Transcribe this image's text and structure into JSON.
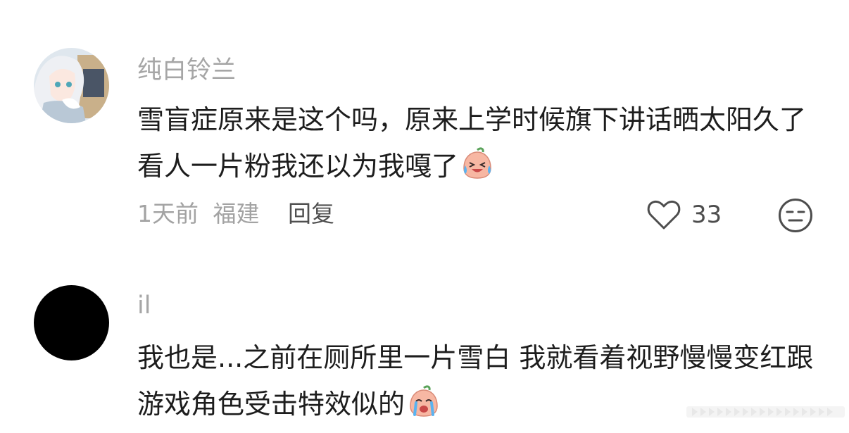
{
  "comments": [
    {
      "username": "纯白铃兰",
      "avatar_icon": "anime-girl-avatar",
      "text": "雪盲症原来是这个吗，原来上学时候旗下讲话晒太阳久了看人一片粉我还以为我嘎了",
      "emoji_icon": "crying-laughing-peach-emoji",
      "time": "1天前",
      "location": "福建",
      "reply_label": "回复",
      "like_icon": "heart-outline-icon",
      "like_count": "33",
      "dislike_icon": "neutral-face-icon"
    },
    {
      "username": "il",
      "avatar_icon": "black-circle-avatar",
      "text": "我也是...之前在厕所里一片雪白 我就看着视野慢慢变红跟游戏角色受击特效似的",
      "emoji_icon": "crying-peach-emoji"
    }
  ],
  "colors": {
    "username": "#a6a6a6",
    "text": "#1d1d1d",
    "meta": "#a3a3a3",
    "reply": "#505050",
    "emoji_pink": "#f7b7a3"
  }
}
